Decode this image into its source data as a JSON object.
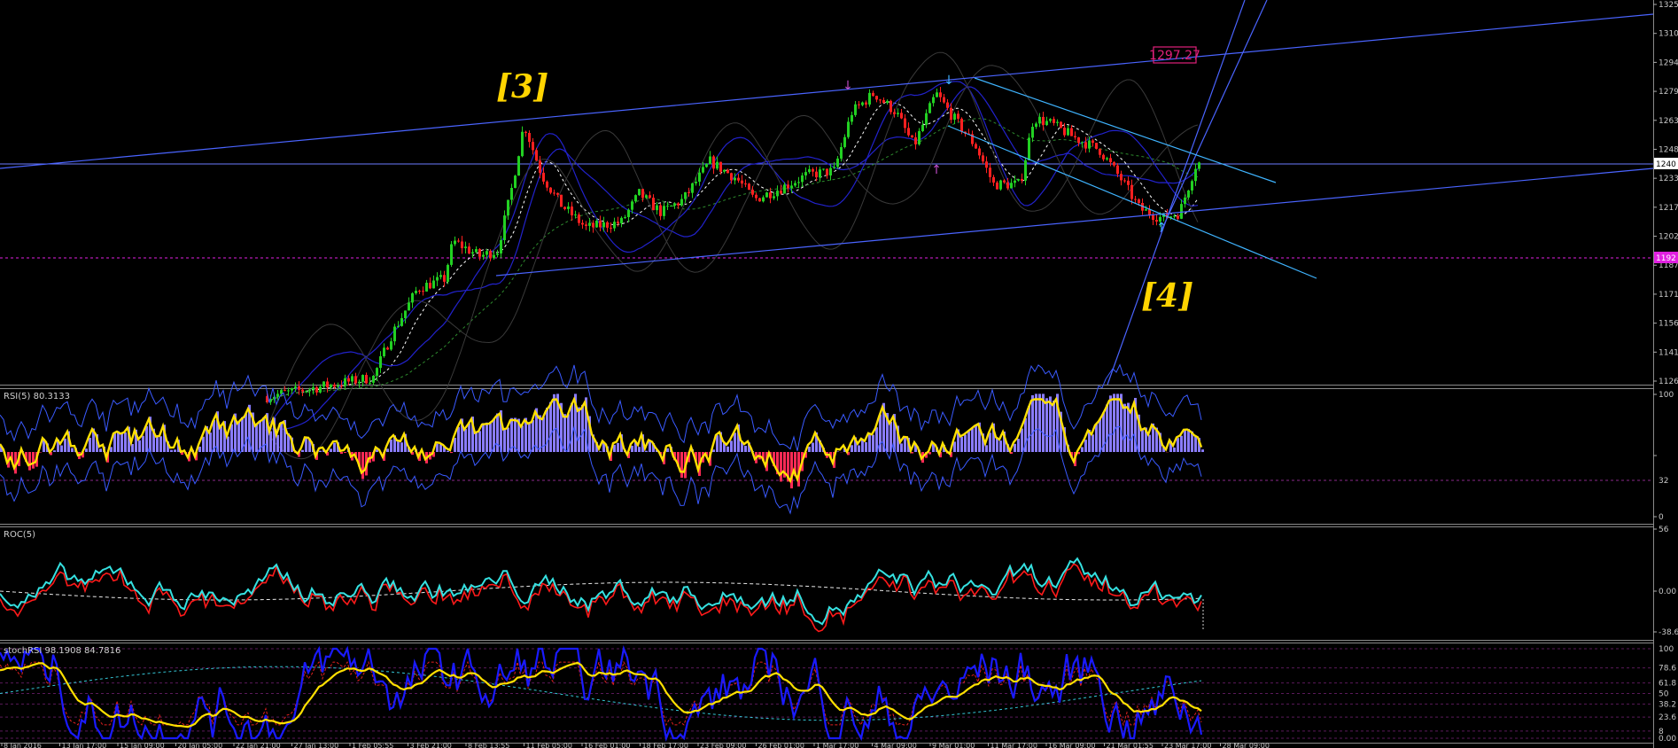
{
  "colors": {
    "background": "#000000",
    "bull_candle": "#22d022",
    "bear_candle": "#ff2020",
    "axis_text": "#c8c8c8",
    "trendline": "#4a64ff",
    "channel": "#3fb4ff",
    "wave_label": "#ffd400",
    "price_box": "#e0207a",
    "rsi_line": "#ffe000",
    "rsi_up_hist": "#8a7cff",
    "rsi_down_hist": "#ff2a55",
    "roc_fast": "#ff1a1a",
    "roc_slow": "#35e0e0",
    "stoch_k": "#1a1aff",
    "stoch_d": "#ffe000"
  },
  "main_panel": {
    "axis_ticks": [
      "1325",
      "1310",
      "1294",
      "1279",
      "1263",
      "1248",
      "1233",
      "1217",
      "1202",
      "1187",
      "1171",
      "1156",
      "1141",
      "1126"
    ],
    "current_price_tag": "1240",
    "dotted_level_tag": "1192",
    "price_box": "1297.27",
    "wave_labels": [
      "[3]",
      "[4]"
    ]
  },
  "rsi_panel": {
    "label": "RSI(5) 80.3133",
    "axis_ticks": [
      "100",
      "32",
      "0"
    ]
  },
  "roc_panel": {
    "label": "ROC(5)",
    "axis_ticks": [
      "56",
      "0.00",
      "-38.6"
    ]
  },
  "stoch_panel": {
    "label": "stochRSI 98.1908 84.7816",
    "axis_ticks": [
      "100",
      "78.6",
      "61.8",
      "50",
      "38.2",
      "23.6",
      "8",
      "0.00"
    ]
  },
  "time_axis": [
    "8 Jan 2016",
    "13 Jan 17:00",
    "15 Jan 09:00",
    "20 Jan 05:00",
    "22 Jan 21:00",
    "27 Jan 13:00",
    "1 Feb 05:55",
    "3 Feb 21:00",
    "8 Feb 13:55",
    "11 Feb 05:00",
    "16 Feb 01:00",
    "18 Feb 17:00",
    "23 Feb 09:00",
    "26 Feb 01:00",
    "1 Mar 17:00",
    "4 Mar 09:00",
    "9 Mar 01:00",
    "11 Mar 17:00",
    "16 Mar 09:00",
    "21 Mar 01:55",
    "23 Mar 17:00",
    "28 Mar 09:00"
  ],
  "chart_data": [
    {
      "type": "candlestick",
      "y_range": [
        1120,
        1330
      ],
      "price_path": [
        [
          0,
          1110
        ],
        [
          300,
          1118
        ],
        [
          420,
          1128
        ],
        [
          440,
          1150
        ],
        [
          470,
          1175
        ],
        [
          500,
          1180
        ],
        [
          510,
          1200
        ],
        [
          540,
          1192
        ],
        [
          560,
          1195
        ],
        [
          575,
          1225
        ],
        [
          590,
          1262
        ],
        [
          610,
          1235
        ],
        [
          630,
          1220
        ],
        [
          660,
          1207
        ],
        [
          700,
          1210
        ],
        [
          720,
          1225
        ],
        [
          745,
          1215
        ],
        [
          770,
          1222
        ],
        [
          800,
          1242
        ],
        [
          830,
          1233
        ],
        [
          850,
          1222
        ],
        [
          880,
          1228
        ],
        [
          910,
          1235
        ],
        [
          940,
          1237
        ],
        [
          960,
          1268
        ],
        [
          985,
          1278
        ],
        [
          1010,
          1268
        ],
        [
          1030,
          1250
        ],
        [
          1055,
          1278
        ],
        [
          1075,
          1265
        ],
        [
          1100,
          1250
        ],
        [
          1120,
          1230
        ],
        [
          1150,
          1230
        ],
        [
          1165,
          1265
        ],
        [
          1185,
          1262
        ],
        [
          1210,
          1255
        ],
        [
          1240,
          1248
        ],
        [
          1265,
          1232
        ],
        [
          1285,
          1217
        ],
        [
          1310,
          1212
        ],
        [
          1330,
          1215
        ],
        [
          1348,
          1240
        ],
        [
          1355,
          1242
        ]
      ]
    },
    {
      "type": "line",
      "name": "RSI(5)",
      "y_range": [
        0,
        100
      ],
      "last": 80.3133
    },
    {
      "type": "line",
      "name": "ROC(5)",
      "y_range": [
        -38.6,
        56
      ]
    },
    {
      "type": "line",
      "name": "stochRSI",
      "y_range": [
        0,
        100
      ],
      "last_k": 98.1908,
      "last_d": 84.7816
    }
  ]
}
